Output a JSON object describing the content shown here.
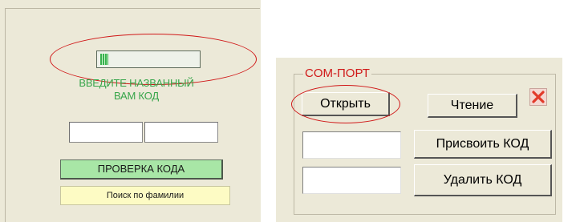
{
  "left_panel": {
    "prompt_line1": "ВВЕДИТЕ НАЗВАННЫЙ",
    "prompt_line2": "ВАМ КОД",
    "code_indicator": {
      "level_fraction": 0.08,
      "color": "#37b24d"
    },
    "check_button_label": "ПРОВЕРКА КОДА",
    "search_button_label": "Поиск по фамилии"
  },
  "right_panel": {
    "group_title": "COM-ПОРТ",
    "open_button_label": "Открыть",
    "read_button_label": "Чтение",
    "assign_button_label": "Присвоить КОД",
    "delete_button_label": "Удалить КОД",
    "close_icon": "close-icon"
  },
  "annotations": {
    "highlight_color": "#d01818"
  }
}
